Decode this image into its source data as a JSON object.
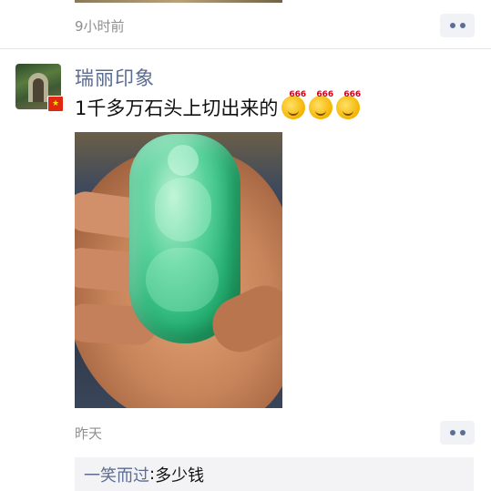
{
  "previous_post": {
    "time": "9小时前"
  },
  "post": {
    "username": "瑞丽印象",
    "text": "1千多万石头上切出来的",
    "emoji_count_label": "666",
    "time": "昨天",
    "image_description_icon": "jade-pendant-photo"
  },
  "comment": {
    "author": "一笑而过",
    "separator": ": ",
    "text": "多少钱"
  },
  "colors": {
    "name_link": "#5b6b92",
    "timestamp": "#8f8f8f",
    "comment_bg": "#f3f3f5"
  }
}
